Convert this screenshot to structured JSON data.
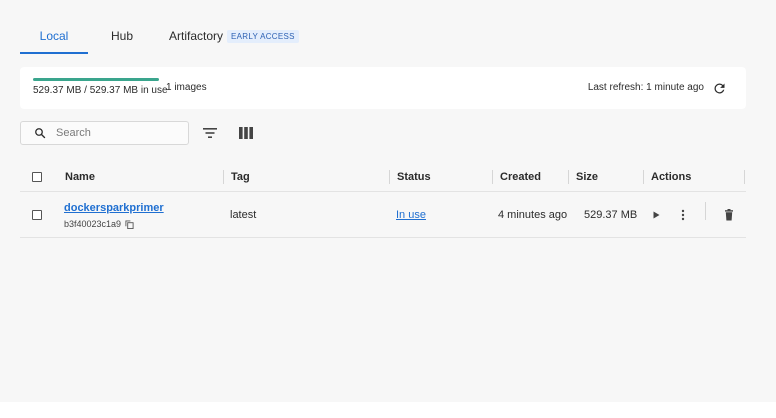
{
  "tabs": [
    {
      "label": "Local",
      "active": true
    },
    {
      "label": "Hub",
      "active": false
    },
    {
      "label": "Artifactory",
      "active": false,
      "badge": "EARLY ACCESS"
    }
  ],
  "usage": {
    "used_text": "529.37 MB / 529.37 MB in use",
    "count_text": "1 images",
    "fill_fraction": 1.0,
    "last_refresh": "Last refresh: 1 minute ago"
  },
  "search": {
    "placeholder": "Search",
    "value": ""
  },
  "table": {
    "columns": [
      "Name",
      "Tag",
      "Status",
      "Created",
      "Size",
      "Actions"
    ],
    "rows": [
      {
        "name": "dockersparkprimer",
        "id": "b3f40023c1a9",
        "tag": "latest",
        "status": "In use",
        "created": "4 minutes ago",
        "size": "529.37 MB"
      }
    ]
  },
  "icons": {
    "refresh": "refresh-icon",
    "search": "search-icon",
    "filter": "filter-icon",
    "columns": "columns-icon",
    "copy": "copy-icon",
    "run": "play-icon",
    "more": "more-vertical-icon",
    "delete": "trash-icon"
  },
  "colors": {
    "accent": "#1f6fd1",
    "usage_bar": "#3aa58d",
    "badge_bg": "#e4eefc"
  }
}
